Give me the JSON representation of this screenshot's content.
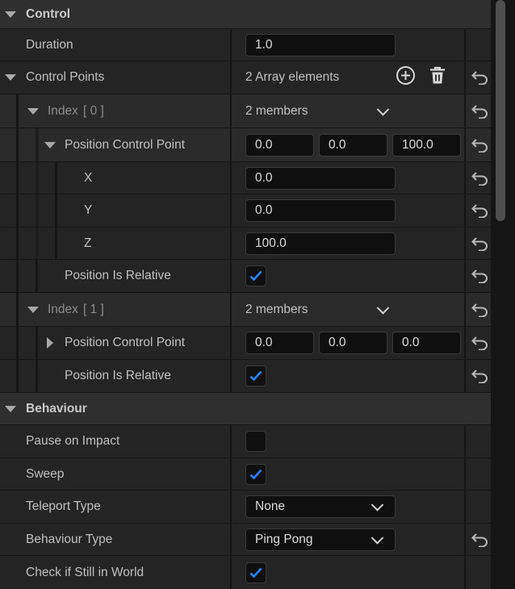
{
  "control": {
    "title": "Control",
    "duration_label": "Duration",
    "duration_value": "1.0",
    "points_label": "Control Points",
    "points_value": "2 Array elements",
    "index0": {
      "label": "Index",
      "bracket": "[ 0 ]",
      "members": "2 members",
      "pos_label": "Position Control Point",
      "pos": [
        "0.0",
        "0.0",
        "100.0"
      ],
      "x_label": "X",
      "x_value": "0.0",
      "y_label": "Y",
      "y_value": "0.0",
      "z_label": "Z",
      "z_value": "100.0",
      "relative_label": "Position Is Relative",
      "relative_checked": true
    },
    "index1": {
      "label": "Index",
      "bracket": "[ 1 ]",
      "members": "2 members",
      "pos_label": "Position Control Point",
      "pos": [
        "0.0",
        "0.0",
        "0.0"
      ],
      "relative_label": "Position Is Relative",
      "relative_checked": true
    }
  },
  "behaviour": {
    "title": "Behaviour",
    "pause_label": "Pause on Impact",
    "pause_checked": false,
    "sweep_label": "Sweep",
    "sweep_checked": true,
    "teleport_label": "Teleport Type",
    "teleport_value": "None",
    "btype_label": "Behaviour Type",
    "btype_value": "Ping Pong",
    "check_world_label": "Check if Still in World",
    "check_world_checked": true
  },
  "icons": {
    "collapse": "triangle-down-icon",
    "expand": "triangle-right-icon",
    "reset": "reset-to-default-icon",
    "add": "plus-circle-icon",
    "delete": "trash-icon",
    "check": "checkmark-icon"
  },
  "colors": {
    "accent": "#1f86ff",
    "background": "#242424",
    "category": "#2f2f2f"
  }
}
